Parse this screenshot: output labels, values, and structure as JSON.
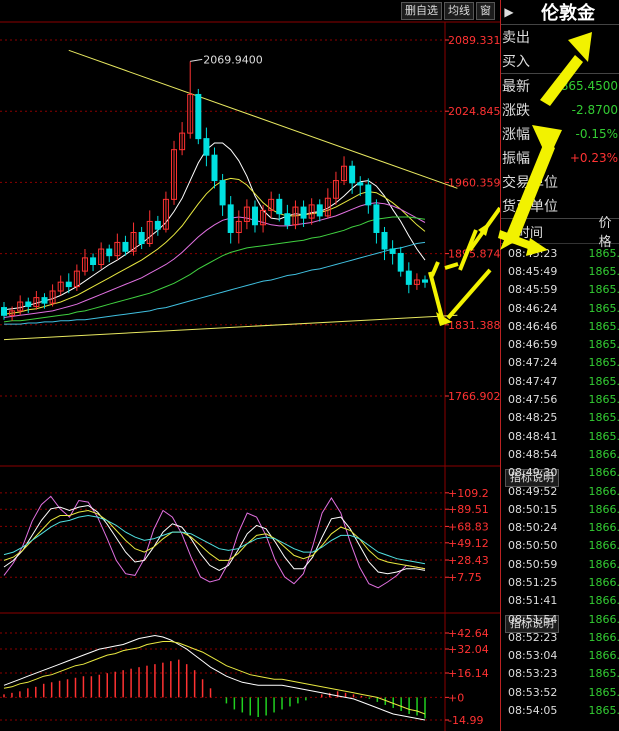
{
  "toolbar": {
    "btn_delete": "删自选",
    "btn_ma": "均线",
    "btn_window": "窗"
  },
  "indicator_label": "指标说明",
  "colors": {
    "up": "#ff3232",
    "down": "#00e0e0",
    "grid": "#8b0000",
    "arrow": "#f2f200"
  },
  "chart_data": [
    {
      "type": "candlestick",
      "title": "",
      "y_axis_ticks": [
        "2089.331",
        "2024.845",
        "1960.359",
        "1895.874",
        "1831.388",
        "1766.902"
      ],
      "ylim": [
        1766.902,
        2089.331
      ],
      "annotation": "2069.9400",
      "candles": [
        [
          1847,
          1840,
          1852,
          1836
        ],
        [
          1840,
          1844,
          1848,
          1835
        ],
        [
          1844,
          1852,
          1858,
          1840
        ],
        [
          1852,
          1848,
          1856,
          1842
        ],
        [
          1848,
          1856,
          1862,
          1845
        ],
        [
          1856,
          1851,
          1860,
          1846
        ],
        [
          1851,
          1862,
          1868,
          1848
        ],
        [
          1862,
          1870,
          1876,
          1858
        ],
        [
          1870,
          1866,
          1878,
          1860
        ],
        [
          1866,
          1880,
          1886,
          1862
        ],
        [
          1880,
          1892,
          1900,
          1876
        ],
        [
          1892,
          1886,
          1896,
          1880
        ],
        [
          1886,
          1900,
          1906,
          1882
        ],
        [
          1900,
          1894,
          1904,
          1888
        ],
        [
          1894,
          1906,
          1914,
          1890
        ],
        [
          1906,
          1898,
          1912,
          1894
        ],
        [
          1898,
          1915,
          1924,
          1894
        ],
        [
          1915,
          1905,
          1920,
          1900
        ],
        [
          1905,
          1925,
          1935,
          1902
        ],
        [
          1925,
          1918,
          1930,
          1912
        ],
        [
          1918,
          1945,
          1952,
          1915
        ],
        [
          1945,
          1990,
          1998,
          1940
        ],
        [
          1990,
          2005,
          2015,
          1985
        ],
        [
          2005,
          2040,
          2069.94,
          2000
        ],
        [
          2040,
          2000,
          2045,
          1995
        ],
        [
          2000,
          1985,
          2010,
          1975
        ],
        [
          1985,
          1962,
          1992,
          1955
        ],
        [
          1962,
          1940,
          1968,
          1930
        ],
        [
          1940,
          1915,
          1948,
          1905
        ],
        [
          1915,
          1925,
          1935,
          1905
        ],
        [
          1925,
          1938,
          1945,
          1918
        ],
        [
          1938,
          1922,
          1944,
          1915
        ],
        [
          1922,
          1935,
          1940,
          1915
        ],
        [
          1935,
          1945,
          1952,
          1928
        ],
        [
          1945,
          1932,
          1950,
          1925
        ],
        [
          1932,
          1922,
          1940,
          1918
        ],
        [
          1922,
          1938,
          1944,
          1918
        ],
        [
          1938,
          1928,
          1944,
          1920
        ],
        [
          1928,
          1940,
          1946,
          1922
        ],
        [
          1940,
          1930,
          1945,
          1925
        ],
        [
          1930,
          1946,
          1955,
          1928
        ],
        [
          1946,
          1962,
          1970,
          1940
        ],
        [
          1962,
          1975,
          1984,
          1958
        ],
        [
          1975,
          1960,
          1980,
          1950
        ],
        [
          1960,
          1958,
          1966,
          1948
        ],
        [
          1958,
          1940,
          1964,
          1932
        ],
        [
          1940,
          1915,
          1945,
          1905
        ],
        [
          1915,
          1900,
          1920,
          1890
        ],
        [
          1900,
          1896,
          1908,
          1886
        ],
        [
          1896,
          1880,
          1902,
          1875
        ],
        [
          1880,
          1868,
          1888,
          1860
        ],
        [
          1868,
          1872,
          1878,
          1863
        ],
        [
          1872,
          1870,
          1876,
          1865
        ]
      ],
      "ma_lines": {
        "white": [
          1845,
          1846,
          1847,
          1849,
          1851,
          1853,
          1855,
          1858,
          1862,
          1866,
          1871,
          1876,
          1881,
          1886,
          1890,
          1895,
          1900,
          1905,
          1911,
          1917,
          1924,
          1934,
          1946,
          1962,
          1978,
          1990,
          1996,
          1996,
          1990,
          1980,
          1966,
          1948,
          1935,
          1928,
          1927,
          1930,
          1932,
          1931,
          1933,
          1934,
          1937,
          1942,
          1948,
          1955,
          1961,
          1962,
          1957,
          1948,
          1936,
          1925,
          1912,
          1900,
          1890
        ],
        "yellow": [
          1841,
          1842,
          1843,
          1845,
          1846,
          1848,
          1850,
          1852,
          1855,
          1858,
          1862,
          1866,
          1870,
          1874,
          1878,
          1882,
          1886,
          1890,
          1895,
          1900,
          1906,
          1913,
          1921,
          1931,
          1941,
          1950,
          1957,
          1962,
          1964,
          1963,
          1958,
          1950,
          1942,
          1936,
          1932,
          1930,
          1930,
          1931,
          1932,
          1933,
          1935,
          1938,
          1942,
          1946,
          1950,
          1952,
          1951,
          1947,
          1942,
          1936,
          1929,
          1922,
          1916
        ],
        "magenta": [
          1838,
          1839,
          1840,
          1841,
          1842,
          1843,
          1844,
          1846,
          1848,
          1850,
          1853,
          1856,
          1859,
          1862,
          1865,
          1868,
          1871,
          1874,
          1878,
          1882,
          1886,
          1891,
          1897,
          1904,
          1911,
          1917,
          1922,
          1926,
          1928,
          1929,
          1928,
          1926,
          1924,
          1922,
          1921,
          1921,
          1922,
          1923,
          1924,
          1926,
          1928,
          1930,
          1933,
          1936,
          1939,
          1941,
          1942,
          1941,
          1939,
          1936,
          1932,
          1928,
          1924
        ],
        "green": [
          1834,
          1835,
          1835,
          1836,
          1837,
          1838,
          1839,
          1840,
          1841,
          1843,
          1844,
          1846,
          1848,
          1850,
          1852,
          1854,
          1856,
          1858,
          1860,
          1863,
          1866,
          1869,
          1873,
          1877,
          1882,
          1886,
          1890,
          1894,
          1897,
          1899,
          1901,
          1902,
          1903,
          1904,
          1905,
          1906,
          1907,
          1908,
          1910,
          1911,
          1913,
          1915,
          1917,
          1920,
          1922,
          1925,
          1927,
          1928,
          1929,
          1929,
          1929,
          1928,
          1927
        ],
        "cyan": [
          1832,
          1832,
          1832,
          1833,
          1833,
          1834,
          1834,
          1835,
          1835,
          1836,
          1836,
          1837,
          1838,
          1839,
          1840,
          1841,
          1842,
          1843,
          1844,
          1846,
          1847,
          1849,
          1851,
          1853,
          1855,
          1857,
          1859,
          1861,
          1863,
          1865,
          1867,
          1869,
          1871,
          1872,
          1874,
          1876,
          1877,
          1879,
          1881,
          1882,
          1884,
          1886,
          1888,
          1890,
          1892,
          1894,
          1896,
          1898,
          1900,
          1901,
          1903,
          1905,
          1906
        ]
      },
      "trendlines": [
        {
          "from": [
            8,
            2080
          ],
          "to": [
            56,
            1955
          ]
        },
        {
          "from": [
            0,
            1818
          ],
          "to": [
            56,
            1840
          ]
        }
      ]
    },
    {
      "type": "line",
      "title": "",
      "y_axis_ticks": [
        "+109.2",
        "+89.51",
        "+68.83",
        "+49.12",
        "+28.43",
        "+7.75"
      ],
      "ylim": [
        -10,
        115
      ],
      "series": [
        {
          "color": "#e070e0",
          "values": [
            10,
            25,
            45,
            75,
            95,
            105,
            90,
            80,
            100,
            98,
            80,
            55,
            28,
            12,
            10,
            30,
            65,
            88,
            80,
            60,
            32,
            8,
            2,
            5,
            25,
            60,
            85,
            80,
            58,
            28,
            8,
            0,
            12,
            45,
            85,
            103,
            85,
            50,
            20,
            0,
            -5,
            2,
            10,
            22,
            20,
            18
          ]
        },
        {
          "color": "#ffffff",
          "values": [
            20,
            28,
            40,
            58,
            76,
            90,
            92,
            88,
            92,
            94,
            86,
            72,
            55,
            38,
            26,
            28,
            44,
            62,
            72,
            68,
            54,
            36,
            22,
            16,
            22,
            40,
            60,
            70,
            66,
            50,
            32,
            18,
            18,
            32,
            56,
            78,
            80,
            66,
            46,
            26,
            14,
            12,
            14,
            18,
            18,
            16
          ]
        },
        {
          "color": "#e8e840",
          "values": [
            28,
            32,
            40,
            52,
            64,
            76,
            82,
            82,
            86,
            88,
            84,
            76,
            64,
            52,
            42,
            38,
            44,
            54,
            62,
            62,
            56,
            46,
            36,
            28,
            28,
            36,
            48,
            58,
            60,
            54,
            44,
            34,
            30,
            34,
            46,
            60,
            68,
            64,
            54,
            40,
            30,
            26,
            24,
            22,
            20,
            18
          ]
        },
        {
          "color": "#50e0e0",
          "values": [
            35,
            38,
            44,
            52,
            60,
            68,
            74,
            76,
            80,
            82,
            80,
            76,
            70,
            62,
            56,
            52,
            54,
            58,
            62,
            62,
            60,
            54,
            48,
            42,
            40,
            42,
            48,
            54,
            56,
            54,
            48,
            42,
            38,
            38,
            44,
            52,
            58,
            58,
            54,
            46,
            38,
            34,
            30,
            28,
            26,
            24
          ]
        }
      ]
    },
    {
      "type": "bar",
      "title": "",
      "y_axis_ticks": [
        "+42.64",
        "+32.04",
        "+16.14",
        "+0",
        "-14.99"
      ],
      "ylim": [
        -14.99,
        42.64
      ],
      "values": [
        2,
        3,
        4,
        6,
        7,
        9,
        10,
        11,
        12,
        13,
        14,
        14,
        15,
        16,
        17,
        18,
        19,
        20,
        21,
        22,
        23,
        24,
        25,
        22,
        18,
        12,
        6,
        0,
        -4,
        -8,
        -10,
        -12,
        -13,
        -12,
        -10,
        -8,
        -6,
        -4,
        -2,
        0,
        2,
        3,
        4,
        3,
        2,
        1,
        -1,
        -3,
        -5,
        -7,
        -9,
        -11,
        -12,
        -14
      ],
      "lines": [
        {
          "color": "#ffffff",
          "values": [
            8,
            10,
            12,
            14,
            16,
            18,
            20,
            22,
            24,
            26,
            28,
            30,
            32,
            33,
            34,
            35,
            37,
            39,
            40,
            41,
            40,
            38,
            35,
            32,
            28,
            24,
            20,
            17,
            14,
            12,
            10,
            9,
            8,
            8,
            8,
            8,
            7,
            6,
            5,
            4,
            3,
            2,
            1,
            0,
            -1,
            -3,
            -5,
            -7,
            -9,
            -11,
            -12,
            -13,
            -14,
            -15
          ]
        },
        {
          "color": "#e8e840",
          "values": [
            6,
            7,
            9,
            10,
            12,
            14,
            15,
            17,
            19,
            21,
            22,
            24,
            26,
            28,
            29,
            31,
            32,
            33,
            35,
            36,
            37,
            37,
            36,
            34,
            32,
            30,
            27,
            24,
            21,
            19,
            17,
            15,
            14,
            13,
            12,
            12,
            11,
            10,
            9,
            8,
            7,
            6,
            5,
            4,
            3,
            2,
            1,
            0,
            -2,
            -4,
            -6,
            -8,
            -9,
            -11
          ]
        }
      ]
    }
  ],
  "panel": {
    "title": "伦敦金 ",
    "flag": "▶",
    "sell_label": "卖出",
    "buy_label": "买入",
    "latest_label": "最新",
    "latest_value": "1865.4500",
    "change_label": "涨跌",
    "change_value": "-2.8700",
    "pct_label": "涨幅",
    "pct_value": "-0.15%",
    "amp_label": "振幅",
    "amp_value": "+0.23%",
    "unit_label": "交易单位",
    "currency_label": "货币单位",
    "time_header": "时间",
    "price_header": "价格",
    "ticks": [
      {
        "time": "08:45:23",
        "price": "1865."
      },
      {
        "time": "08:45:49",
        "price": "1865."
      },
      {
        "time": "08:45:59",
        "price": "1865."
      },
      {
        "time": "08:46:24",
        "price": "1865."
      },
      {
        "time": "08:46:46",
        "price": "1865."
      },
      {
        "time": "08:46:59",
        "price": "1865."
      },
      {
        "time": "08:47:24",
        "price": "1865."
      },
      {
        "time": "08:47:47",
        "price": "1865."
      },
      {
        "time": "08:47:56",
        "price": "1865."
      },
      {
        "time": "08:48:25",
        "price": "1865."
      },
      {
        "time": "08:48:41",
        "price": "1865."
      },
      {
        "time": "08:48:54",
        "price": "1866."
      },
      {
        "time": "08:49:30",
        "price": "1866."
      },
      {
        "time": "08:49:52",
        "price": "1866."
      },
      {
        "time": "08:50:15",
        "price": "1866."
      },
      {
        "time": "08:50:24",
        "price": "1866."
      },
      {
        "time": "08:50:50",
        "price": "1866."
      },
      {
        "time": "08:50:59",
        "price": "1866."
      },
      {
        "time": "08:51:25",
        "price": "1866."
      },
      {
        "time": "08:51:41",
        "price": "1866."
      },
      {
        "time": "08:51:54",
        "price": "1866."
      },
      {
        "time": "08:52:23",
        "price": "1866."
      },
      {
        "time": "08:53:04",
        "price": "1866."
      },
      {
        "time": "08:53:23",
        "price": "1865."
      },
      {
        "time": "08:53:52",
        "price": "1865."
      },
      {
        "time": "08:54:05",
        "price": "1865."
      }
    ]
  }
}
